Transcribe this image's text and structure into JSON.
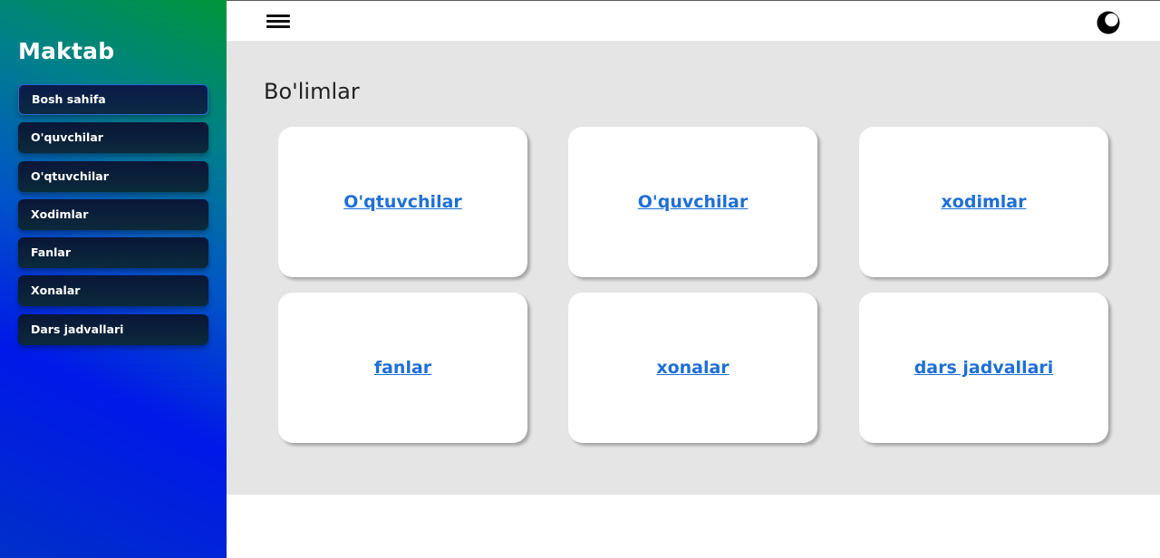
{
  "sidebar": {
    "brand": "Maktab",
    "items": [
      {
        "label": "Bosh sahifa",
        "active": true
      },
      {
        "label": "O'quvchilar",
        "active": false
      },
      {
        "label": "O'qtuvchilar",
        "active": false
      },
      {
        "label": "Xodimlar",
        "active": false
      },
      {
        "label": "Fanlar",
        "active": false
      },
      {
        "label": "Xonalar",
        "active": false
      },
      {
        "label": "Dars jadvallari",
        "active": false
      }
    ]
  },
  "topbar": {
    "menu_icon": "hamburger-menu-icon",
    "theme_icon": "moon-icon"
  },
  "main": {
    "title": "Bo'limlar",
    "cards": [
      {
        "label": "O'qtuvchilar"
      },
      {
        "label": "O'quvchilar"
      },
      {
        "label": "xodimlar"
      },
      {
        "label": "fanlar"
      },
      {
        "label": "xonalar"
      },
      {
        "label": "dars jadvallari"
      }
    ]
  },
  "colors": {
    "link": "#1f6fd6",
    "main_bg": "#e5e5e5",
    "sidebar_gradient_top": "#00963a",
    "sidebar_gradient_bottom": "#0018e8"
  }
}
